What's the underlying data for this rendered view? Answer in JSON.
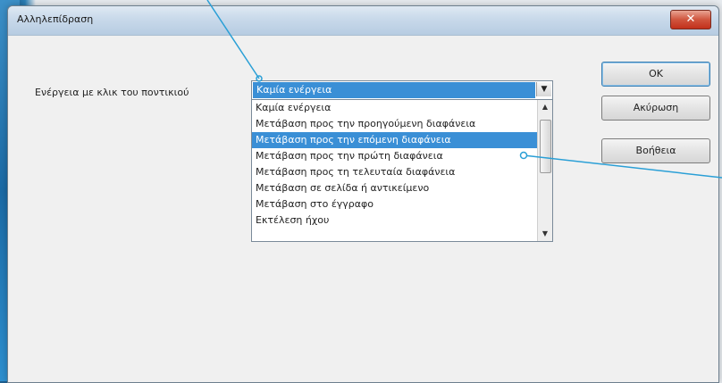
{
  "window": {
    "title": "Αλληλεπίδραση",
    "close_glyph": "✕"
  },
  "form": {
    "action_label": "Ενέργεια με κλικ του ποντικιού",
    "selected_value": "Καμία ενέργεια",
    "dropdown_arrow": "▼"
  },
  "list": {
    "items": [
      "Καμία ενέργεια",
      "Μετάβαση προς την προηγούμενη διαφάνεια",
      "Μετάβαση προς την επόμενη διαφάνεια",
      "Μετάβαση προς την πρώτη διαφάνεια",
      "Μετάβαση προς τη τελευταία διαφάνεια",
      "Μετάβαση σε σελίδα ή αντικείμενο",
      "Μετάβαση στο έγγραφο",
      "Εκτέλεση ήχου"
    ],
    "selected_index": 2,
    "scroll_up": "▲",
    "scroll_down": "▼"
  },
  "buttons": {
    "ok": "OK",
    "cancel": "Ακύρωση",
    "help": "Βοήθεια"
  },
  "colors": {
    "selection": "#3a8fd6",
    "callout_line": "#2a9fd6"
  }
}
